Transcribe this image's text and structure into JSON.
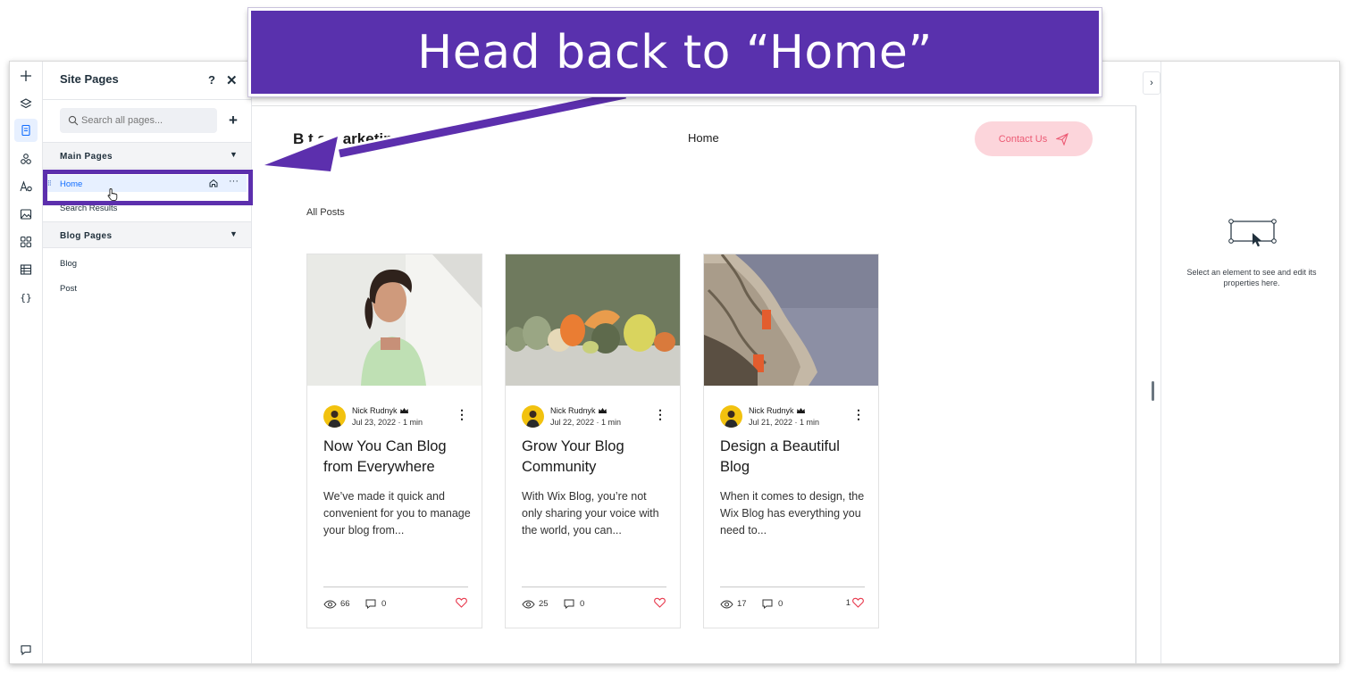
{
  "callout": {
    "text": "Head back to “Home”"
  },
  "colors": {
    "accent": "#5931ad",
    "selected": "#116dff",
    "contact_bg": "#fcd5db",
    "contact_text": "#ec5a74",
    "heart": "#e8394d"
  },
  "rail": {
    "icons": [
      "plus-icon",
      "layers-icon",
      "pages-icon",
      "design-icon",
      "text-theme-icon",
      "media-icon",
      "apps-icon",
      "cms-table-icon",
      "code-icon",
      "chat-icon"
    ]
  },
  "pages_panel": {
    "title": "Site Pages",
    "help": "?",
    "close": "✕",
    "search_placeholder": "Search all pages...",
    "add": "+",
    "main_section": "Main Pages",
    "main_items": [
      "Home",
      "Search Results"
    ],
    "blog_section": "Blog Pages",
    "blog_items": [
      "Blog",
      "Post"
    ],
    "more": "···"
  },
  "site": {
    "title": "Business Marketing",
    "title_visible_fragment": "B        t       s Marketing",
    "nav_home": "Home",
    "contact_button": "Contact Us",
    "all_posts": "All Posts"
  },
  "posts": [
    {
      "author": "Nick Rudnyk",
      "date": "Jul 23, 2022",
      "read": "1 min",
      "title": "Now You Can Blog from Everywhere",
      "excerpt": "We’ve made it quick and convenient for you to manage your blog from...",
      "views": "66",
      "comments": "0",
      "likes": ""
    },
    {
      "author": "Nick Rudnyk",
      "date": "Jul 22, 2022",
      "read": "1 min",
      "title": "Grow Your Blog Community",
      "excerpt": "With Wix Blog, you’re not only sharing your voice with the world, you can...",
      "views": "25",
      "comments": "0",
      "likes": ""
    },
    {
      "author": "Nick Rudnyk",
      "date": "Jul 21, 2022",
      "read": "1 min",
      "title": "Design a Beautiful Blog",
      "excerpt": "When it comes to design, the Wix Blog has everything you need to...",
      "views": "17",
      "comments": "0",
      "likes": "1"
    }
  ],
  "inspector": {
    "message": "Select an element to see and edit its properties here."
  }
}
